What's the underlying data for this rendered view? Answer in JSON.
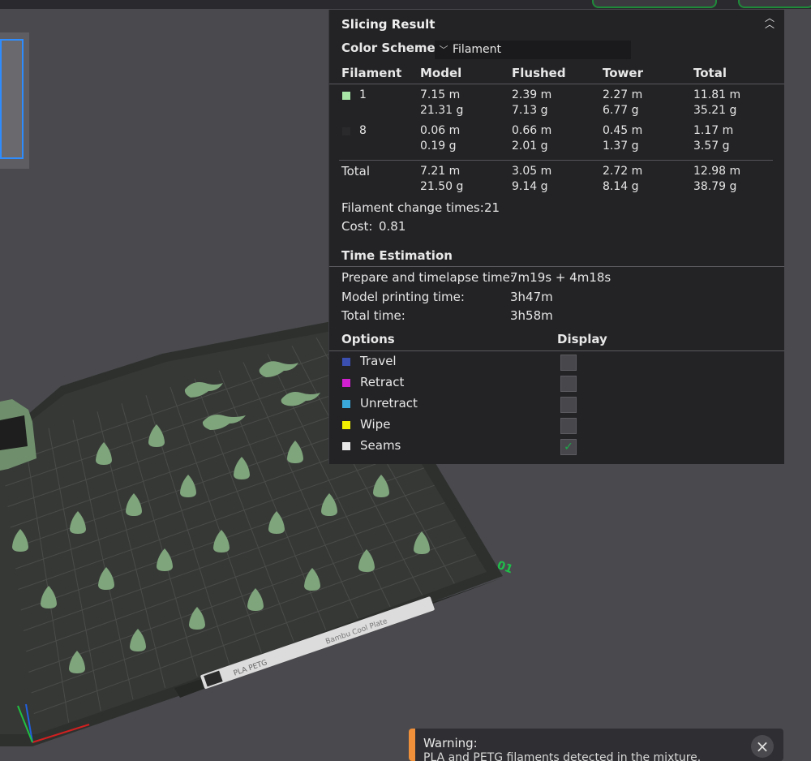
{
  "slicing_result": {
    "title": "Slicing Result",
    "color_scheme_label": "Color Scheme",
    "color_scheme_value": "Filament",
    "columns": [
      "Filament",
      "Model",
      "Flushed",
      "Tower",
      "Total"
    ],
    "rows": [
      {
        "id": "1",
        "color": "#a8e6a8",
        "model": [
          "7.15 m",
          "21.31 g"
        ],
        "flushed": [
          "2.39 m",
          "7.13 g"
        ],
        "tower": [
          "2.27 m",
          "6.77 g"
        ],
        "total": [
          "11.81 m",
          "35.21 g"
        ]
      },
      {
        "id": "8",
        "color": "#2a2a2c",
        "model": [
          "0.06 m",
          "0.19 g"
        ],
        "flushed": [
          "0.66 m",
          "2.01 g"
        ],
        "tower": [
          "0.45 m",
          "1.37 g"
        ],
        "total": [
          "1.17 m",
          "3.57 g"
        ]
      }
    ],
    "totals": {
      "label": "Total",
      "model": [
        "7.21 m",
        "21.50 g"
      ],
      "flushed": [
        "3.05 m",
        "9.14 g"
      ],
      "tower": [
        "2.72 m",
        "8.14 g"
      ],
      "total": [
        "12.98 m",
        "38.79 g"
      ]
    },
    "filament_change_label": "Filament change times:",
    "filament_change_value": "21",
    "cost_label": "Cost:",
    "cost_value": "0.81"
  },
  "time_estimation": {
    "title": "Time Estimation",
    "prepare_label": "Prepare and timelapse time:",
    "prepare_value": "7m19s + 4m18s",
    "model_label": "Model printing time:",
    "model_value": "3h47m",
    "total_label": "Total time:",
    "total_value": "3h58m"
  },
  "options": {
    "title": "Options",
    "display_title": "Display",
    "items": [
      {
        "label": "Travel",
        "color": "#3a4fb0",
        "checked": false
      },
      {
        "label": "Retract",
        "color": "#d020d0",
        "checked": false
      },
      {
        "label": "Unretract",
        "color": "#3aa8d8",
        "checked": false
      },
      {
        "label": "Wipe",
        "color": "#f0f000",
        "checked": false
      },
      {
        "label": "Seams",
        "color": "#e8e8e8",
        "checked": true
      }
    ]
  },
  "plate": {
    "number": "01",
    "label": "Bambu Cool Plate",
    "brand": "PLA PETG"
  },
  "warning": {
    "title": "Warning:",
    "message": "PLA and PETG filaments detected in the mixture."
  }
}
